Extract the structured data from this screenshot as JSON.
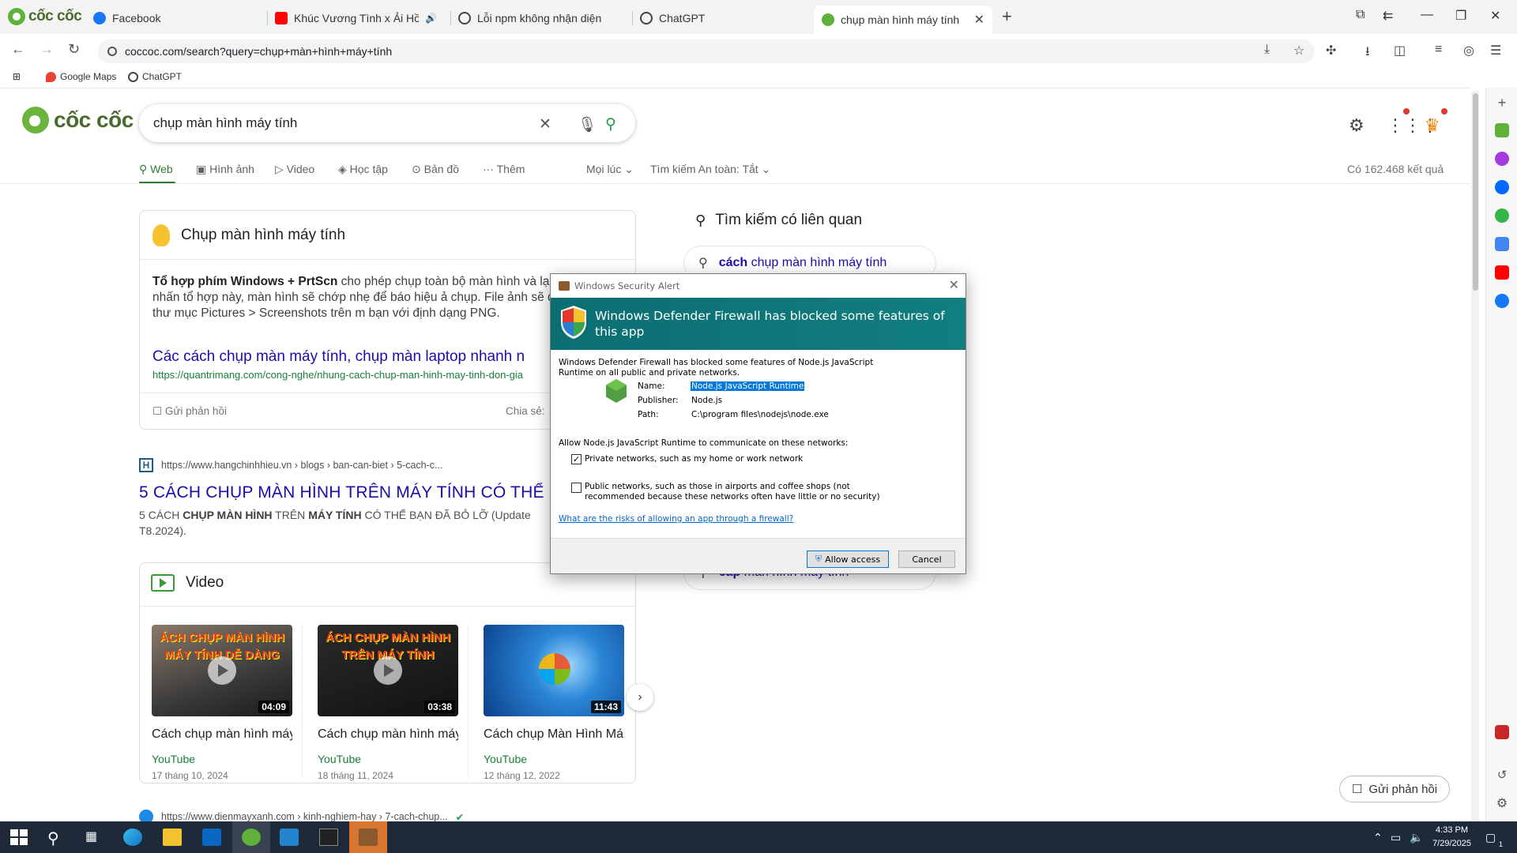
{
  "browser": {
    "brand": "cốc cốc",
    "tabs": [
      {
        "label": "Facebook",
        "color": "#1877f2"
      },
      {
        "label": "Khúc Vương Tình x Ải Hồng",
        "color": "#ff0000"
      },
      {
        "label": "Lỗi npm không nhận diện",
        "color": "#444444"
      },
      {
        "label": "ChatGPT",
        "color": "#444444"
      },
      {
        "label": "chụp màn hình máy tính - T",
        "color": "#5fb13a"
      }
    ],
    "url": "coccoc.com/search?query=chụp+màn+hình+máy+tính",
    "bookmarks": [
      "Google Maps",
      "ChatGPT"
    ]
  },
  "search": {
    "logo_text": "cốc cốc",
    "query": "chụp màn hình máy tính",
    "tabs": [
      "Web",
      "Hình ảnh",
      "Video",
      "Học tập",
      "Bản đồ",
      "Thêm"
    ],
    "filters": [
      "Mọi lúc",
      "Tìm kiếm An toàn: Tắt"
    ],
    "result_count": "Có 162.468 kết quả"
  },
  "featured": {
    "heading": "Chụp màn hình máy tính",
    "text_bold": "Tổ hợp phím Windows + PrtScn",
    "text_rest": " cho phép chụp toàn bộ màn hình và lại ảnh. Sau khi nhấn tổ hợp này, màn hình sẽ chớp nhẹ để báo hiệu ả chụp. File ảnh sẽ được lưu vào thư mục Pictures > Screenshots trên m bạn với định dạng PNG.",
    "link_title": "Các cách chụp màn máy tính, chụp màn laptop nhanh n",
    "link_url": "https://quantrimang.com/cong-nghe/nhung-cach-chup-man-hinh-may-tinh-don-gia",
    "feedback": "Gửi phản hồi",
    "share": "Chia sẻ:"
  },
  "result2": {
    "favicon": "H",
    "url": "https://www.hangchinhhieu.vn › blogs › ban-can-biet › 5-cach-c...",
    "title": "5 CÁCH CHỤP MÀN HÌNH TRÊN MÁY TÍNH CÓ THỂ ...",
    "snippet_p1": "5 CÁCH ",
    "snippet_b1": "CHỤP MÀN HÌNH",
    "snippet_p2": " TRÊN ",
    "snippet_b2": "MÁY TÍNH",
    "snippet_p3": " CÓ THỂ BẠN ĐÃ BỎ LỠ (Update T8.2024)."
  },
  "videos": {
    "heading": "Video",
    "items": [
      {
        "caption": "ÁCH CHỤP MÀN HÌNH MÁY TÍNH DỄ DÀNG",
        "duration": "04:09",
        "title": "Cách chụp màn hình máy",
        "source": "YouTube",
        "date": "17 tháng 10, 2024"
      },
      {
        "caption": "ÁCH CHỤP MÀN HÌNH TRÊN MÁY TÍNH",
        "duration": "03:38",
        "title": "Cách chụp màn hình máy",
        "source": "YouTube",
        "date": "18 tháng 11, 2024"
      },
      {
        "caption": "",
        "duration": "11:43",
        "title": "Cách chụp Màn Hình Má",
        "source": "YouTube",
        "date": "12 tháng 12, 2022"
      }
    ]
  },
  "result3": {
    "url": "https://www.dienmayxanh.com › kinh-nghiem-hay › 7-cach-chup..."
  },
  "related": {
    "heading": "Tìm kiếm có liên quan",
    "item1_bold": "cách",
    "item1_rest": " chụp màn hình máy tính",
    "item2_bold": "cap",
    "item2_rest": " màn hình máy tính"
  },
  "feedback_button": "Gửi phản hồi",
  "dialog": {
    "title": "Windows Security Alert",
    "banner": "Windows Defender Firewall has blocked some features of this app",
    "message": "Windows Defender Firewall has blocked some features of Node.js JavaScript Runtime on all public and private networks.",
    "name_label": "Name:",
    "name_value": "Node.js JavaScript Runtime",
    "publisher_label": "Publisher:",
    "publisher_value": "Node.js",
    "path_label": "Path:",
    "path_value": "C:\\program files\\nodejs\\node.exe",
    "allow_text": "Allow Node.js JavaScript Runtime to communicate on these networks:",
    "private_label": "Private networks, such as my home or work network",
    "private_checked": true,
    "public_label": "Public networks, such as those in airports and coffee shops (not recommended because these networks often have little or no security)",
    "public_checked": false,
    "risk_link": "What are the risks of allowing an app through a firewall?",
    "allow_button": "Allow access",
    "cancel_button": "Cancel"
  },
  "taskbar": {
    "time": "4:33 PM",
    "date": "7/29/2025",
    "notification_count": "1"
  }
}
